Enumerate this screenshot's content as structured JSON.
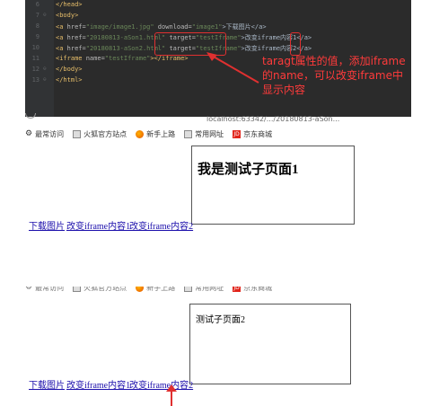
{
  "editor": {
    "lines": [
      {
        "num": "6",
        "code_tag": "</head>"
      },
      {
        "num": "7",
        "code_tag": "<body>"
      },
      {
        "num": "8",
        "tag_open": "<a ",
        "a1": "href=",
        "v1": "\"image/image1.jpg\"",
        "a2": " download=",
        "v2": "\"image1\"",
        "end": ">下载图片</a>"
      },
      {
        "num": "9",
        "tag_open": "<a ",
        "a1": "href=",
        "v1": "\"20180813-aSon1.html\"",
        "a2": " target=",
        "v2": "\"testIframe\"",
        "end": ">改变iframe内容1</a>"
      },
      {
        "num": "10",
        "tag_open": "<a ",
        "a1": "href=",
        "v1": "\"20180813-aSon2.html\"",
        "a2": " target=",
        "v2": "\"testIframe\"",
        "end": ">改变iframe内容2</a>"
      },
      {
        "num": "11",
        "tag_open": "<iframe ",
        "a1": "name=",
        "v1": "\"testIframe\"",
        "end": "></iframe>"
      },
      {
        "num": "12",
        "code_tag": "</body>"
      },
      {
        "num": "13",
        "code_tag": "</html>"
      }
    ],
    "annotation": "taragt属性的值，添加iframe的name，可以改变iframe中显示内容",
    "accent_color": "#e03030"
  },
  "browser": {
    "bookmarks": [
      {
        "label": "最常访问",
        "icon": "gear-icon"
      },
      {
        "label": "火狐官方站点",
        "icon": "folder-icon"
      },
      {
        "label": "新手上路",
        "icon": "firefox-icon"
      },
      {
        "label": "常用网址",
        "icon": "folder-icon"
      },
      {
        "label": "京东商城",
        "icon": "jd-icon"
      }
    ],
    "url_fragment": "localhost:63342/.../20180813-aSon..."
  },
  "page1": {
    "links": [
      "下载图片",
      "改变iframe内容1",
      "改变iframe内容2"
    ],
    "iframe_heading": "我是测试子页面1"
  },
  "page2": {
    "links": [
      "下载图片",
      "改变iframe内容1",
      "改变iframe内容2"
    ],
    "iframe_text": "测试子页面2"
  }
}
